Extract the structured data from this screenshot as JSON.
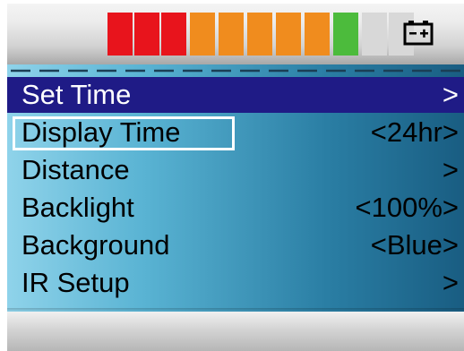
{
  "status_bar": {
    "battery_level_fraction": 0.75,
    "battery_icon": "battery-icon",
    "segment_colors": [
      "#e8141c",
      "#e8141c",
      "#e8141c",
      "#f08c1e",
      "#f08c1e",
      "#f08c1e",
      "#f08c1e",
      "#f08c1e",
      "#4cbb3c",
      "#d8d8d8",
      "#d8d8d8"
    ]
  },
  "colors": {
    "selected_row_background": "#1f1b86",
    "selected_row_text": "#ffffff",
    "menu_text": "#000000",
    "focus_border": "#ffffff"
  },
  "menu": {
    "items": [
      {
        "label": "Set Time",
        "value": ">"
      },
      {
        "label": "Display Time",
        "value": "<24hr>"
      },
      {
        "label": "Distance",
        "value": ">"
      },
      {
        "label": "Backlight",
        "value": "<100%>"
      },
      {
        "label": "Background",
        "value": "<Blue>"
      },
      {
        "label": "IR Setup",
        "value": ">"
      }
    ],
    "selected_index": 0,
    "focused_index": 1
  }
}
